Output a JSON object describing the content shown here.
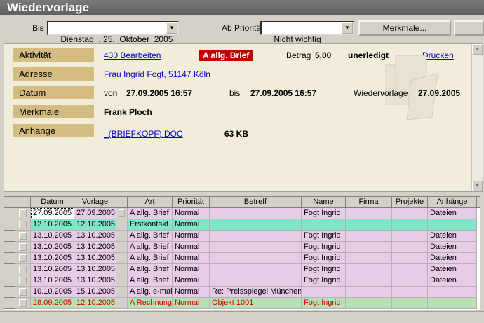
{
  "window": {
    "title": "Wiedervorlage"
  },
  "toolbar": {
    "bis_label": "Bis",
    "bis_date": "Dienstag  , 25.  Oktober  2005",
    "prio_label": "Ab Priorität",
    "prio_value": "Nicht wichtig",
    "merkmale_button": "Merkmale..."
  },
  "detail": {
    "aktivitaet_label": "Aktivität",
    "aktivitaet_value": "430  Bearbeiten",
    "type_badge": "A allg. Brief",
    "betrag_label": "Betrag",
    "betrag_value": "5,00",
    "status": "unerledigt",
    "drucken": "Drucken",
    "adresse_label": "Adresse",
    "adresse_value": "Frau Ingrid Fogt,  51147 Köln",
    "datum_label": "Datum",
    "von_label": "von",
    "von_value": "27.09.2005 16:57",
    "bis_label": "bis",
    "bis_value": "27.09.2005 16:57",
    "wv_label": "Wiedervorlage",
    "wv_value": "27.09.2005",
    "merkmale_label": "Merkmale",
    "merkmale_value": "Frank Ploch",
    "anhaenge_label": "Anhänge",
    "anhang_file": "_(BRIEFKOPF).DOC",
    "anhang_size": "63 KB"
  },
  "table": {
    "headers": [
      "Datum",
      "Vorlage",
      "Art",
      "Priorität",
      "Betreff",
      "Name",
      "Firma",
      "Projekte",
      "Anhänge"
    ],
    "rows": [
      {
        "datum": "27.09.2005",
        "vorlage": "27.09.2005",
        "art": "A allg. Brief",
        "prio": "Normal",
        "betreff": "",
        "name": "Fogt Ingrid",
        "firma": "",
        "projekte": "",
        "anhaenge": "Dateien",
        "color": "#e6cce6",
        "text": "#000000"
      },
      {
        "datum": "12.10.2005",
        "vorlage": "12.10.2005",
        "art": "Erstkontakt",
        "prio": "Normal",
        "betreff": "",
        "name": "",
        "firma": "",
        "projekte": "",
        "anhaenge": "",
        "color": "#7fe6c8",
        "text": "#000000"
      },
      {
        "datum": "13.10.2005",
        "vorlage": "13.10.2005",
        "art": "A allg. Brief",
        "prio": "Normal",
        "betreff": "",
        "name": "Fogt Ingrid",
        "firma": "",
        "projekte": "",
        "anhaenge": "Dateien",
        "color": "#e6cce6",
        "text": "#000000"
      },
      {
        "datum": "13.10.2005",
        "vorlage": "13.10.2005",
        "art": "A allg. Brief",
        "prio": "Normal",
        "betreff": "",
        "name": "Fogt Ingrid",
        "firma": "",
        "projekte": "",
        "anhaenge": "Dateien",
        "color": "#e6cce6",
        "text": "#000000"
      },
      {
        "datum": "13.10.2005",
        "vorlage": "13.10.2005",
        "art": "A allg. Brief",
        "prio": "Normal",
        "betreff": "",
        "name": "Fogt Ingrid",
        "firma": "",
        "projekte": "",
        "anhaenge": "Dateien",
        "color": "#e6cce6",
        "text": "#000000"
      },
      {
        "datum": "13.10.2005",
        "vorlage": "13.10.2005",
        "art": "A allg. Brief",
        "prio": "Normal",
        "betreff": "",
        "name": "Fogt Ingrid",
        "firma": "",
        "projekte": "",
        "anhaenge": "Dateien",
        "color": "#e6cce6",
        "text": "#000000"
      },
      {
        "datum": "13.10.2005",
        "vorlage": "13.10.2005",
        "art": "A allg. Brief",
        "prio": "Normal",
        "betreff": "",
        "name": "Fogt Ingrid",
        "firma": "",
        "projekte": "",
        "anhaenge": "Dateien",
        "color": "#e6cce6",
        "text": "#000000"
      },
      {
        "datum": "10.10.2005",
        "vorlage": "15.10.2005",
        "art": "A allg. e-mail",
        "prio": "Normal",
        "betreff": "Re: Preisspiegel München",
        "name": "",
        "firma": "",
        "projekte": "",
        "anhaenge": "",
        "color": "#e6cce6",
        "text": "#000000"
      },
      {
        "datum": "28.09.2005",
        "vorlage": "12.10.2005",
        "art": "A Rechnung",
        "prio": "Normal",
        "betreff": "Objekt 1001",
        "name": "Fogt Ingrid",
        "firma": "",
        "projekte": "",
        "anhaenge": "",
        "color": "#b8e0b4",
        "text": "#cc0000"
      }
    ]
  }
}
